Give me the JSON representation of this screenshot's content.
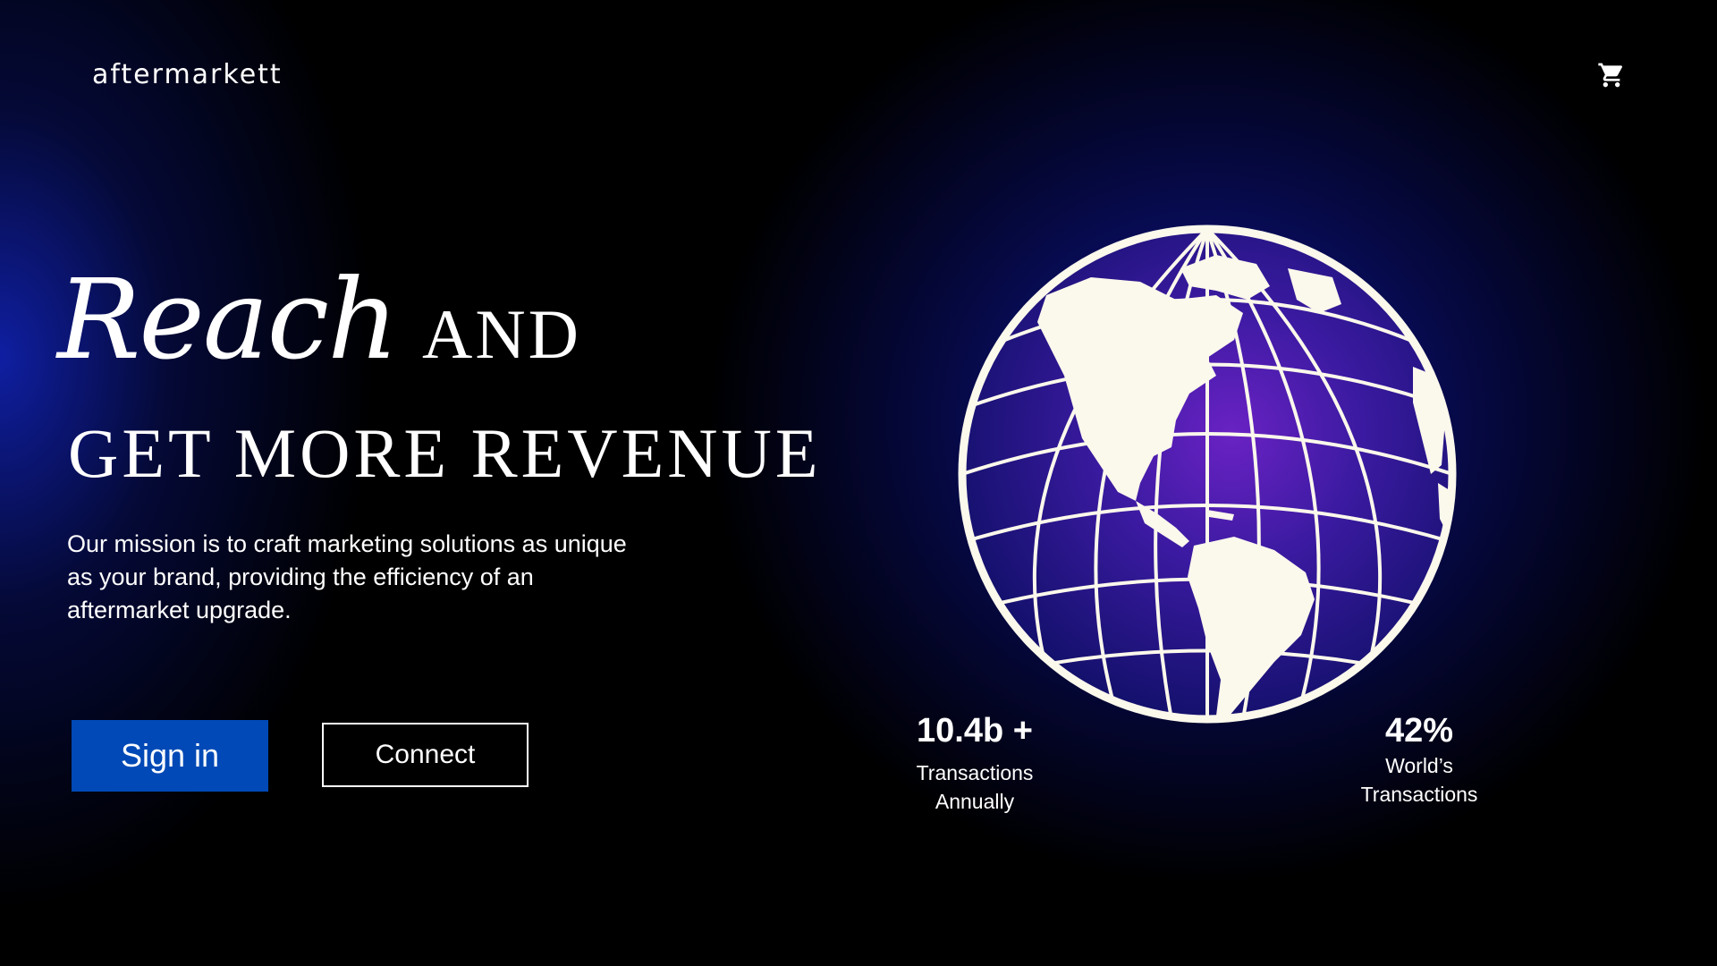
{
  "header": {
    "logo": "aftermarkett",
    "cart_icon": "cart-icon"
  },
  "hero": {
    "script_word": "Reach",
    "and_word": "AND",
    "headline_line2": "GET MORE REVENUE",
    "mission": "Our mission is to craft marketing solutions as unique as your brand, providing the efficiency of an aftermarket upgrade."
  },
  "buttons": {
    "signin_label": "Sign in",
    "connect_label": "Connect"
  },
  "stats": [
    {
      "value": "10.4b +",
      "label_line1": "Transactions",
      "label_line2": "Annually"
    },
    {
      "value": "42%",
      "label_line1": "World’s",
      "label_line2": "Transactions"
    }
  ],
  "colors": {
    "background": "#000000",
    "accent_blue": "#0049b6",
    "glow_blue": "#1224be",
    "globe_purple": "#5a1fb0",
    "globe_line": "#fbf8ec"
  },
  "globe_icon": "globe-icon"
}
